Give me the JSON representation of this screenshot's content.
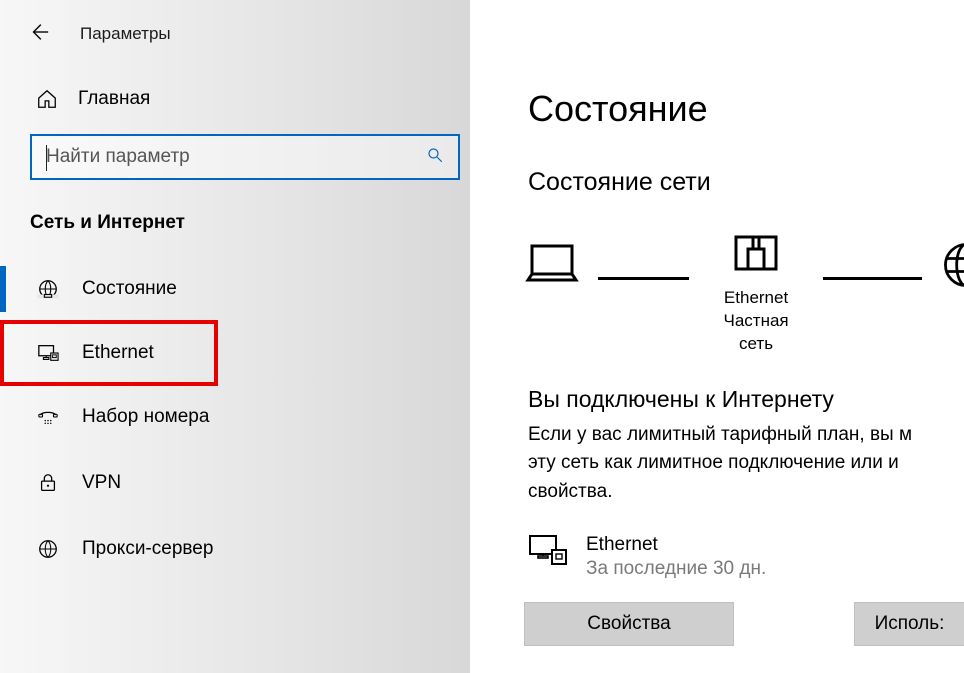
{
  "app": {
    "title": "Параметры"
  },
  "home": {
    "label": "Главная"
  },
  "search": {
    "placeholder": "Найти параметр"
  },
  "section": {
    "title": "Сеть и Интернет"
  },
  "nav": [
    {
      "label": "Состояние"
    },
    {
      "label": "Ethernet"
    },
    {
      "label": "Набор номера"
    },
    {
      "label": "VPN"
    },
    {
      "label": "Прокси-сервер"
    }
  ],
  "page": {
    "title": "Состояние",
    "network_status_heading": "Состояние сети",
    "diagram": {
      "router_name": "Ethernet",
      "router_sub": "Частная сеть"
    },
    "connected_title": "Вы подключены к Интернету",
    "connected_desc_line1": "Если у вас лимитный тарифный план, вы м",
    "connected_desc_line2": "эту сеть как лимитное подключение или и",
    "connected_desc_line3": "свойства.",
    "adapter": {
      "name": "Ethernet",
      "sub": "За последние 30 дн."
    },
    "buttons": {
      "properties": "Свойства",
      "usage_partial": "Исполь:"
    }
  }
}
